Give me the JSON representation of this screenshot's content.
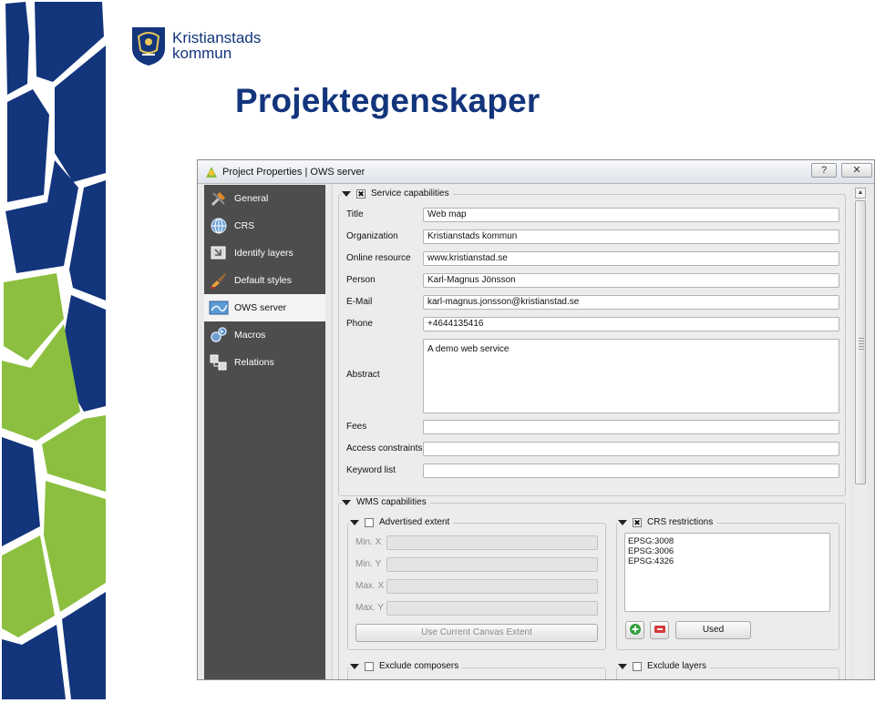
{
  "slide": {
    "title": "Projektegenskaper",
    "logo_line1": "Kristianstads",
    "logo_line2": "kommun"
  },
  "colors": {
    "brand_blue": "#12357c",
    "brand_green": "#8cbf3f",
    "sidebar_dark": "#4d4d4d"
  },
  "dialog": {
    "title": "Project Properties | OWS server",
    "help_label": "?",
    "close_label": "✕"
  },
  "sidebar": {
    "items": [
      {
        "label": "General",
        "icon": "wrench-hammer-icon"
      },
      {
        "label": "CRS",
        "icon": "globe-icon"
      },
      {
        "label": "Identify layers",
        "icon": "identify-icon"
      },
      {
        "label": "Default styles",
        "icon": "paintbrush-icon"
      },
      {
        "label": "OWS server",
        "icon": "map-icon"
      },
      {
        "label": "Macros",
        "icon": "gears-icon"
      },
      {
        "label": "Relations",
        "icon": "relations-icon"
      }
    ],
    "active": "OWS server"
  },
  "service": {
    "header": "Service capabilities",
    "checked": true,
    "fields": [
      {
        "label": "Title",
        "value": "Web map"
      },
      {
        "label": "Organization",
        "value": "Kristianstads kommun"
      },
      {
        "label": "Online resource",
        "value": "www.kristianstad.se"
      },
      {
        "label": "Person",
        "value": "Karl-Magnus Jönsson"
      },
      {
        "label": "E-Mail",
        "value": "karl-magnus.jonsson@kristianstad.se"
      },
      {
        "label": "Phone",
        "value": "+4644135416"
      }
    ],
    "abstract_label": "Abstract",
    "abstract_value": "A demo web service",
    "fees_label": "Fees",
    "fees_value": "",
    "access_label": "Access constraints",
    "access_value": "",
    "keyword_label": "Keyword list",
    "keyword_value": ""
  },
  "wms": {
    "header": "WMS capabilities",
    "extent": {
      "header": "Advertised extent",
      "checked": false,
      "min_x": "Min. X",
      "min_y": "Min. Y",
      "max_x": "Max. X",
      "max_y": "Max. Y",
      "use_canvas": "Use Current Canvas Extent"
    },
    "crs": {
      "header": "CRS restrictions",
      "checked": true,
      "codes": [
        "EPSG:3008",
        "EPSG:3006",
        "EPSG:4326"
      ],
      "used_label": "Used"
    },
    "exclude_composers": "Exclude composers",
    "exclude_layers": "Exclude layers"
  }
}
